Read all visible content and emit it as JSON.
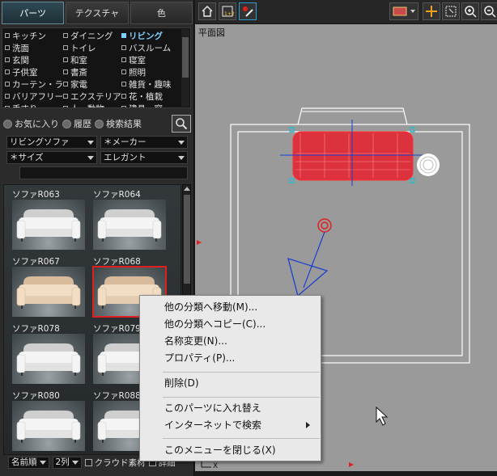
{
  "tabs": [
    {
      "label": "パーツ",
      "active": true
    },
    {
      "label": "テクスチャ",
      "active": false
    },
    {
      "label": "色",
      "active": false
    }
  ],
  "categories": [
    {
      "label": "キッチン",
      "selected": false
    },
    {
      "label": "ダイニング",
      "selected": false
    },
    {
      "label": "リビング",
      "selected": true
    },
    {
      "label": "洗面",
      "selected": false
    },
    {
      "label": "トイレ",
      "selected": false
    },
    {
      "label": "バスルーム",
      "selected": false
    },
    {
      "label": "玄関",
      "selected": false
    },
    {
      "label": "和室",
      "selected": false
    },
    {
      "label": "寝室",
      "selected": false
    },
    {
      "label": "子供室",
      "selected": false
    },
    {
      "label": "書斎",
      "selected": false
    },
    {
      "label": "照明",
      "selected": false
    },
    {
      "label": "カーテン・ラグ",
      "selected": false
    },
    {
      "label": "家電",
      "selected": false
    },
    {
      "label": "雑貨・趣味",
      "selected": false
    },
    {
      "label": "バリアフリー",
      "selected": false
    },
    {
      "label": "エクステリア",
      "selected": false
    },
    {
      "label": "花・植栽",
      "selected": false
    },
    {
      "label": "手すり",
      "selected": false
    },
    {
      "label": "人・動物",
      "selected": false
    },
    {
      "label": "建具・窓",
      "selected": false
    }
  ],
  "filters": {
    "favorites": "お気に入り",
    "history": "履歴",
    "search_results": "検索結果"
  },
  "dropdowns": {
    "subcategory": "リビングソファ",
    "maker": "＊メーカー",
    "size": "＊サイズ",
    "style": "エレガント"
  },
  "parts": [
    {
      "name": "ソファR063",
      "color": "white",
      "selected": false
    },
    {
      "name": "ソファR064",
      "color": "white",
      "selected": false
    },
    {
      "name": "ソファR067",
      "color": "beige",
      "selected": false
    },
    {
      "name": "ソファR068",
      "color": "beige",
      "selected": true
    },
    {
      "name": "ソファR078",
      "color": "white",
      "selected": false
    },
    {
      "name": "ソファR079",
      "color": "white",
      "selected": false
    },
    {
      "name": "ソファR080",
      "color": "white",
      "selected": false
    },
    {
      "name": "ソファR088",
      "color": "white",
      "selected": false
    }
  ],
  "bottom": {
    "sort": "名前順",
    "columns": "2列",
    "cloud_label": "クラウド素材",
    "detail_label": "詳細"
  },
  "view": {
    "label": "平面図",
    "axis_x": "X"
  },
  "context_menu": {
    "move": "他の分類へ移動(M)...",
    "copy": "他の分類へコピー(C)...",
    "rename": "名称変更(N)...",
    "properties": "プロパティ(P)...",
    "delete": "削除(D)",
    "replace": "このパーツに入れ替え",
    "web_search": "インターネットで検索",
    "close": "このメニューを閉じる(X)"
  },
  "colors": {
    "selected_category": "#7fd0ff",
    "selection_outline": "#e02020",
    "sofa_red": "#e8202e",
    "view_bg": "#9a9a9a"
  }
}
